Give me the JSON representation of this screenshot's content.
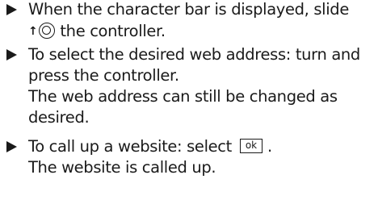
{
  "steps": [
    {
      "lines": [
        "When the character bar is displayed, slide",
        "the controller."
      ]
    },
    {
      "lines": [
        "To select the desired web address: turn and",
        "press the controller."
      ],
      "result": [
        "The web address can still be changed as",
        "desired."
      ]
    },
    {
      "lines": [
        "To call up a website: select",
        "."
      ],
      "ok_button_label": "ok",
      "result": [
        "The website is called up."
      ]
    }
  ],
  "icons": {
    "slide_direction": "arrow-up",
    "controller": "controller-knob"
  }
}
